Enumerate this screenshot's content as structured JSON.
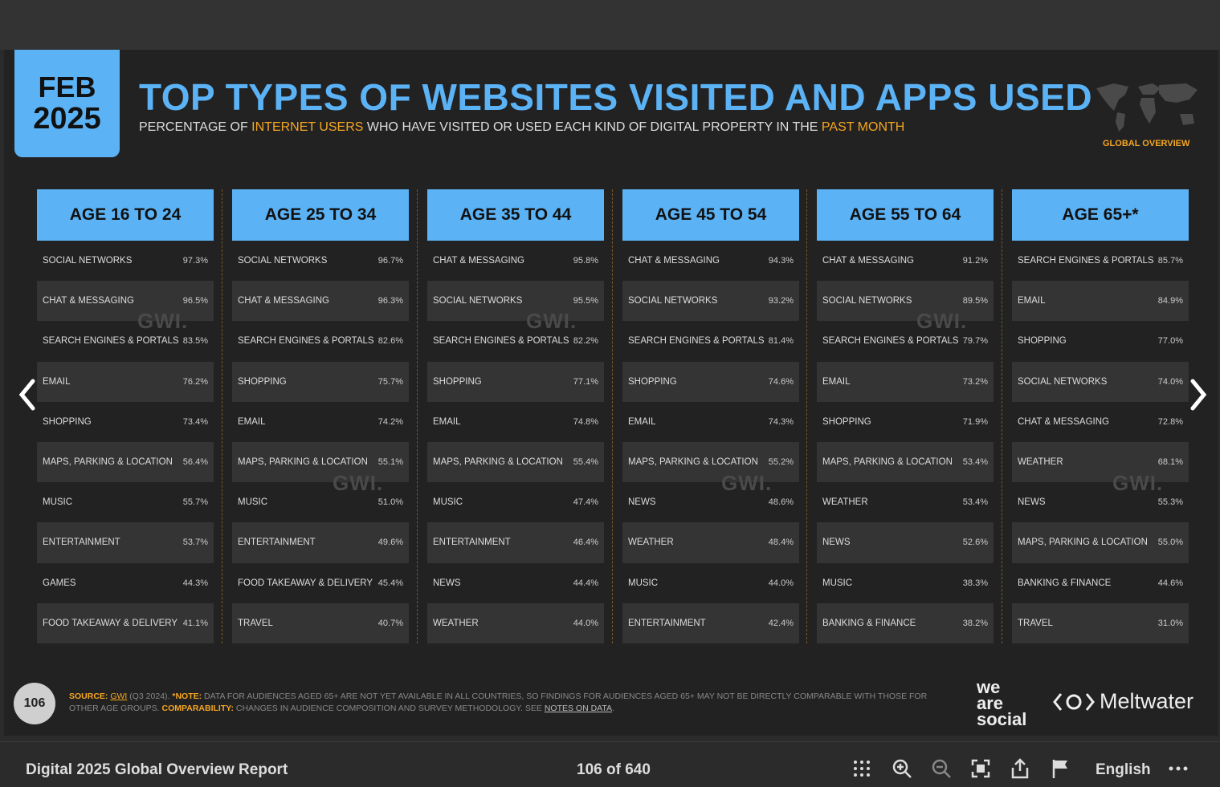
{
  "header": {
    "month": "FEB",
    "year": "2025",
    "title": "TOP TYPES OF WEBSITES VISITED AND APPS USED",
    "subtitle_pre": "PERCENTAGE OF ",
    "subtitle_hl1": "INTERNET USERS",
    "subtitle_mid": " WHO HAVE VISITED OR USED EACH KIND OF DIGITAL PROPERTY IN THE ",
    "subtitle_hl2": "PAST MONTH",
    "badge": "GLOBAL OVERVIEW"
  },
  "watermark": "GWI.",
  "columns": [
    {
      "label": "AGE 16 TO 24",
      "rows": [
        {
          "name": "SOCIAL NETWORKS",
          "value": "97.3%"
        },
        {
          "name": "CHAT & MESSAGING",
          "value": "96.5%"
        },
        {
          "name": "SEARCH ENGINES & PORTALS",
          "value": "83.5%"
        },
        {
          "name": "EMAIL",
          "value": "76.2%"
        },
        {
          "name": "SHOPPING",
          "value": "73.4%"
        },
        {
          "name": "MAPS, PARKING & LOCATION",
          "value": "56.4%"
        },
        {
          "name": "MUSIC",
          "value": "55.7%"
        },
        {
          "name": "ENTERTAINMENT",
          "value": "53.7%"
        },
        {
          "name": "GAMES",
          "value": "44.3%"
        },
        {
          "name": "FOOD TAKEAWAY & DELIVERY",
          "value": "41.1%"
        }
      ]
    },
    {
      "label": "AGE 25 TO 34",
      "rows": [
        {
          "name": "SOCIAL NETWORKS",
          "value": "96.7%"
        },
        {
          "name": "CHAT & MESSAGING",
          "value": "96.3%"
        },
        {
          "name": "SEARCH ENGINES & PORTALS",
          "value": "82.6%"
        },
        {
          "name": "SHOPPING",
          "value": "75.7%"
        },
        {
          "name": "EMAIL",
          "value": "74.2%"
        },
        {
          "name": "MAPS, PARKING & LOCATION",
          "value": "55.1%"
        },
        {
          "name": "MUSIC",
          "value": "51.0%"
        },
        {
          "name": "ENTERTAINMENT",
          "value": "49.6%"
        },
        {
          "name": "FOOD TAKEAWAY & DELIVERY",
          "value": "45.4%"
        },
        {
          "name": "TRAVEL",
          "value": "40.7%"
        }
      ]
    },
    {
      "label": "AGE 35 TO 44",
      "rows": [
        {
          "name": "CHAT & MESSAGING",
          "value": "95.8%"
        },
        {
          "name": "SOCIAL NETWORKS",
          "value": "95.5%"
        },
        {
          "name": "SEARCH ENGINES & PORTALS",
          "value": "82.2%"
        },
        {
          "name": "SHOPPING",
          "value": "77.1%"
        },
        {
          "name": "EMAIL",
          "value": "74.8%"
        },
        {
          "name": "MAPS, PARKING & LOCATION",
          "value": "55.4%"
        },
        {
          "name": "MUSIC",
          "value": "47.4%"
        },
        {
          "name": "ENTERTAINMENT",
          "value": "46.4%"
        },
        {
          "name": "NEWS",
          "value": "44.4%"
        },
        {
          "name": "WEATHER",
          "value": "44.0%"
        }
      ]
    },
    {
      "label": "AGE 45 TO 54",
      "rows": [
        {
          "name": "CHAT & MESSAGING",
          "value": "94.3%"
        },
        {
          "name": "SOCIAL NETWORKS",
          "value": "93.2%"
        },
        {
          "name": "SEARCH ENGINES & PORTALS",
          "value": "81.4%"
        },
        {
          "name": "SHOPPING",
          "value": "74.6%"
        },
        {
          "name": "EMAIL",
          "value": "74.3%"
        },
        {
          "name": "MAPS, PARKING & LOCATION",
          "value": "55.2%"
        },
        {
          "name": "NEWS",
          "value": "48.6%"
        },
        {
          "name": "WEATHER",
          "value": "48.4%"
        },
        {
          "name": "MUSIC",
          "value": "44.0%"
        },
        {
          "name": "ENTERTAINMENT",
          "value": "42.4%"
        }
      ]
    },
    {
      "label": "AGE 55 TO 64",
      "rows": [
        {
          "name": "CHAT & MESSAGING",
          "value": "91.2%"
        },
        {
          "name": "SOCIAL NETWORKS",
          "value": "89.5%"
        },
        {
          "name": "SEARCH ENGINES & PORTALS",
          "value": "79.7%"
        },
        {
          "name": "EMAIL",
          "value": "73.2%"
        },
        {
          "name": "SHOPPING",
          "value": "71.9%"
        },
        {
          "name": "MAPS, PARKING & LOCATION",
          "value": "53.4%"
        },
        {
          "name": "WEATHER",
          "value": "53.4%"
        },
        {
          "name": "NEWS",
          "value": "52.6%"
        },
        {
          "name": "MUSIC",
          "value": "38.3%"
        },
        {
          "name": "BANKING & FINANCE",
          "value": "38.2%"
        }
      ]
    },
    {
      "label": "AGE 65+*",
      "rows": [
        {
          "name": "SEARCH ENGINES & PORTALS",
          "value": "85.7%"
        },
        {
          "name": "EMAIL",
          "value": "84.9%"
        },
        {
          "name": "SHOPPING",
          "value": "77.0%"
        },
        {
          "name": "SOCIAL NETWORKS",
          "value": "74.0%"
        },
        {
          "name": "CHAT & MESSAGING",
          "value": "72.8%"
        },
        {
          "name": "WEATHER",
          "value": "68.1%"
        },
        {
          "name": "NEWS",
          "value": "55.3%"
        },
        {
          "name": "MAPS, PARKING & LOCATION",
          "value": "55.0%"
        },
        {
          "name": "BANKING & FINANCE",
          "value": "44.6%"
        },
        {
          "name": "TRAVEL",
          "value": "31.0%"
        }
      ]
    }
  ],
  "footer": {
    "page_number": "106",
    "source_label": "SOURCE:",
    "source_gwi": "GWI",
    "source_text": " (Q3 2024). ",
    "note_label": "*NOTE:",
    "note_text": " DATA FOR AUDIENCES AGED 65+ ARE NOT YET AVAILABLE IN ALL COUNTRIES, SO FINDINGS FOR AUDIENCES AGED 65+ MAY NOT BE DIRECTLY COMPARABLE WITH THOSE FOR OTHER AGE GROUPS. ",
    "comp_label": "COMPARABILITY:",
    "comp_text": " CHANGES IN AUDIENCE COMPOSITION AND SURVEY METHODOLOGY. SEE ",
    "notes_link": "NOTES ON DATA",
    "notes_end": ".",
    "logo1_line1": "we",
    "logo1_line2": "are",
    "logo1_line3": "social",
    "logo2": "Meltwater"
  },
  "viewer": {
    "doc_title": "Digital 2025 Global Overview Report",
    "page_count": "106 of 640",
    "language": "English"
  },
  "icons": [
    "prev-arrow-icon",
    "next-arrow-icon",
    "grid-icon",
    "zoom-in-icon",
    "zoom-out-icon",
    "fullscreen-icon",
    "share-icon",
    "flag-icon",
    "more-icon"
  ],
  "colors": {
    "accent": "#5bb2f5",
    "highlight": "#f5a623",
    "background": "#222222"
  }
}
